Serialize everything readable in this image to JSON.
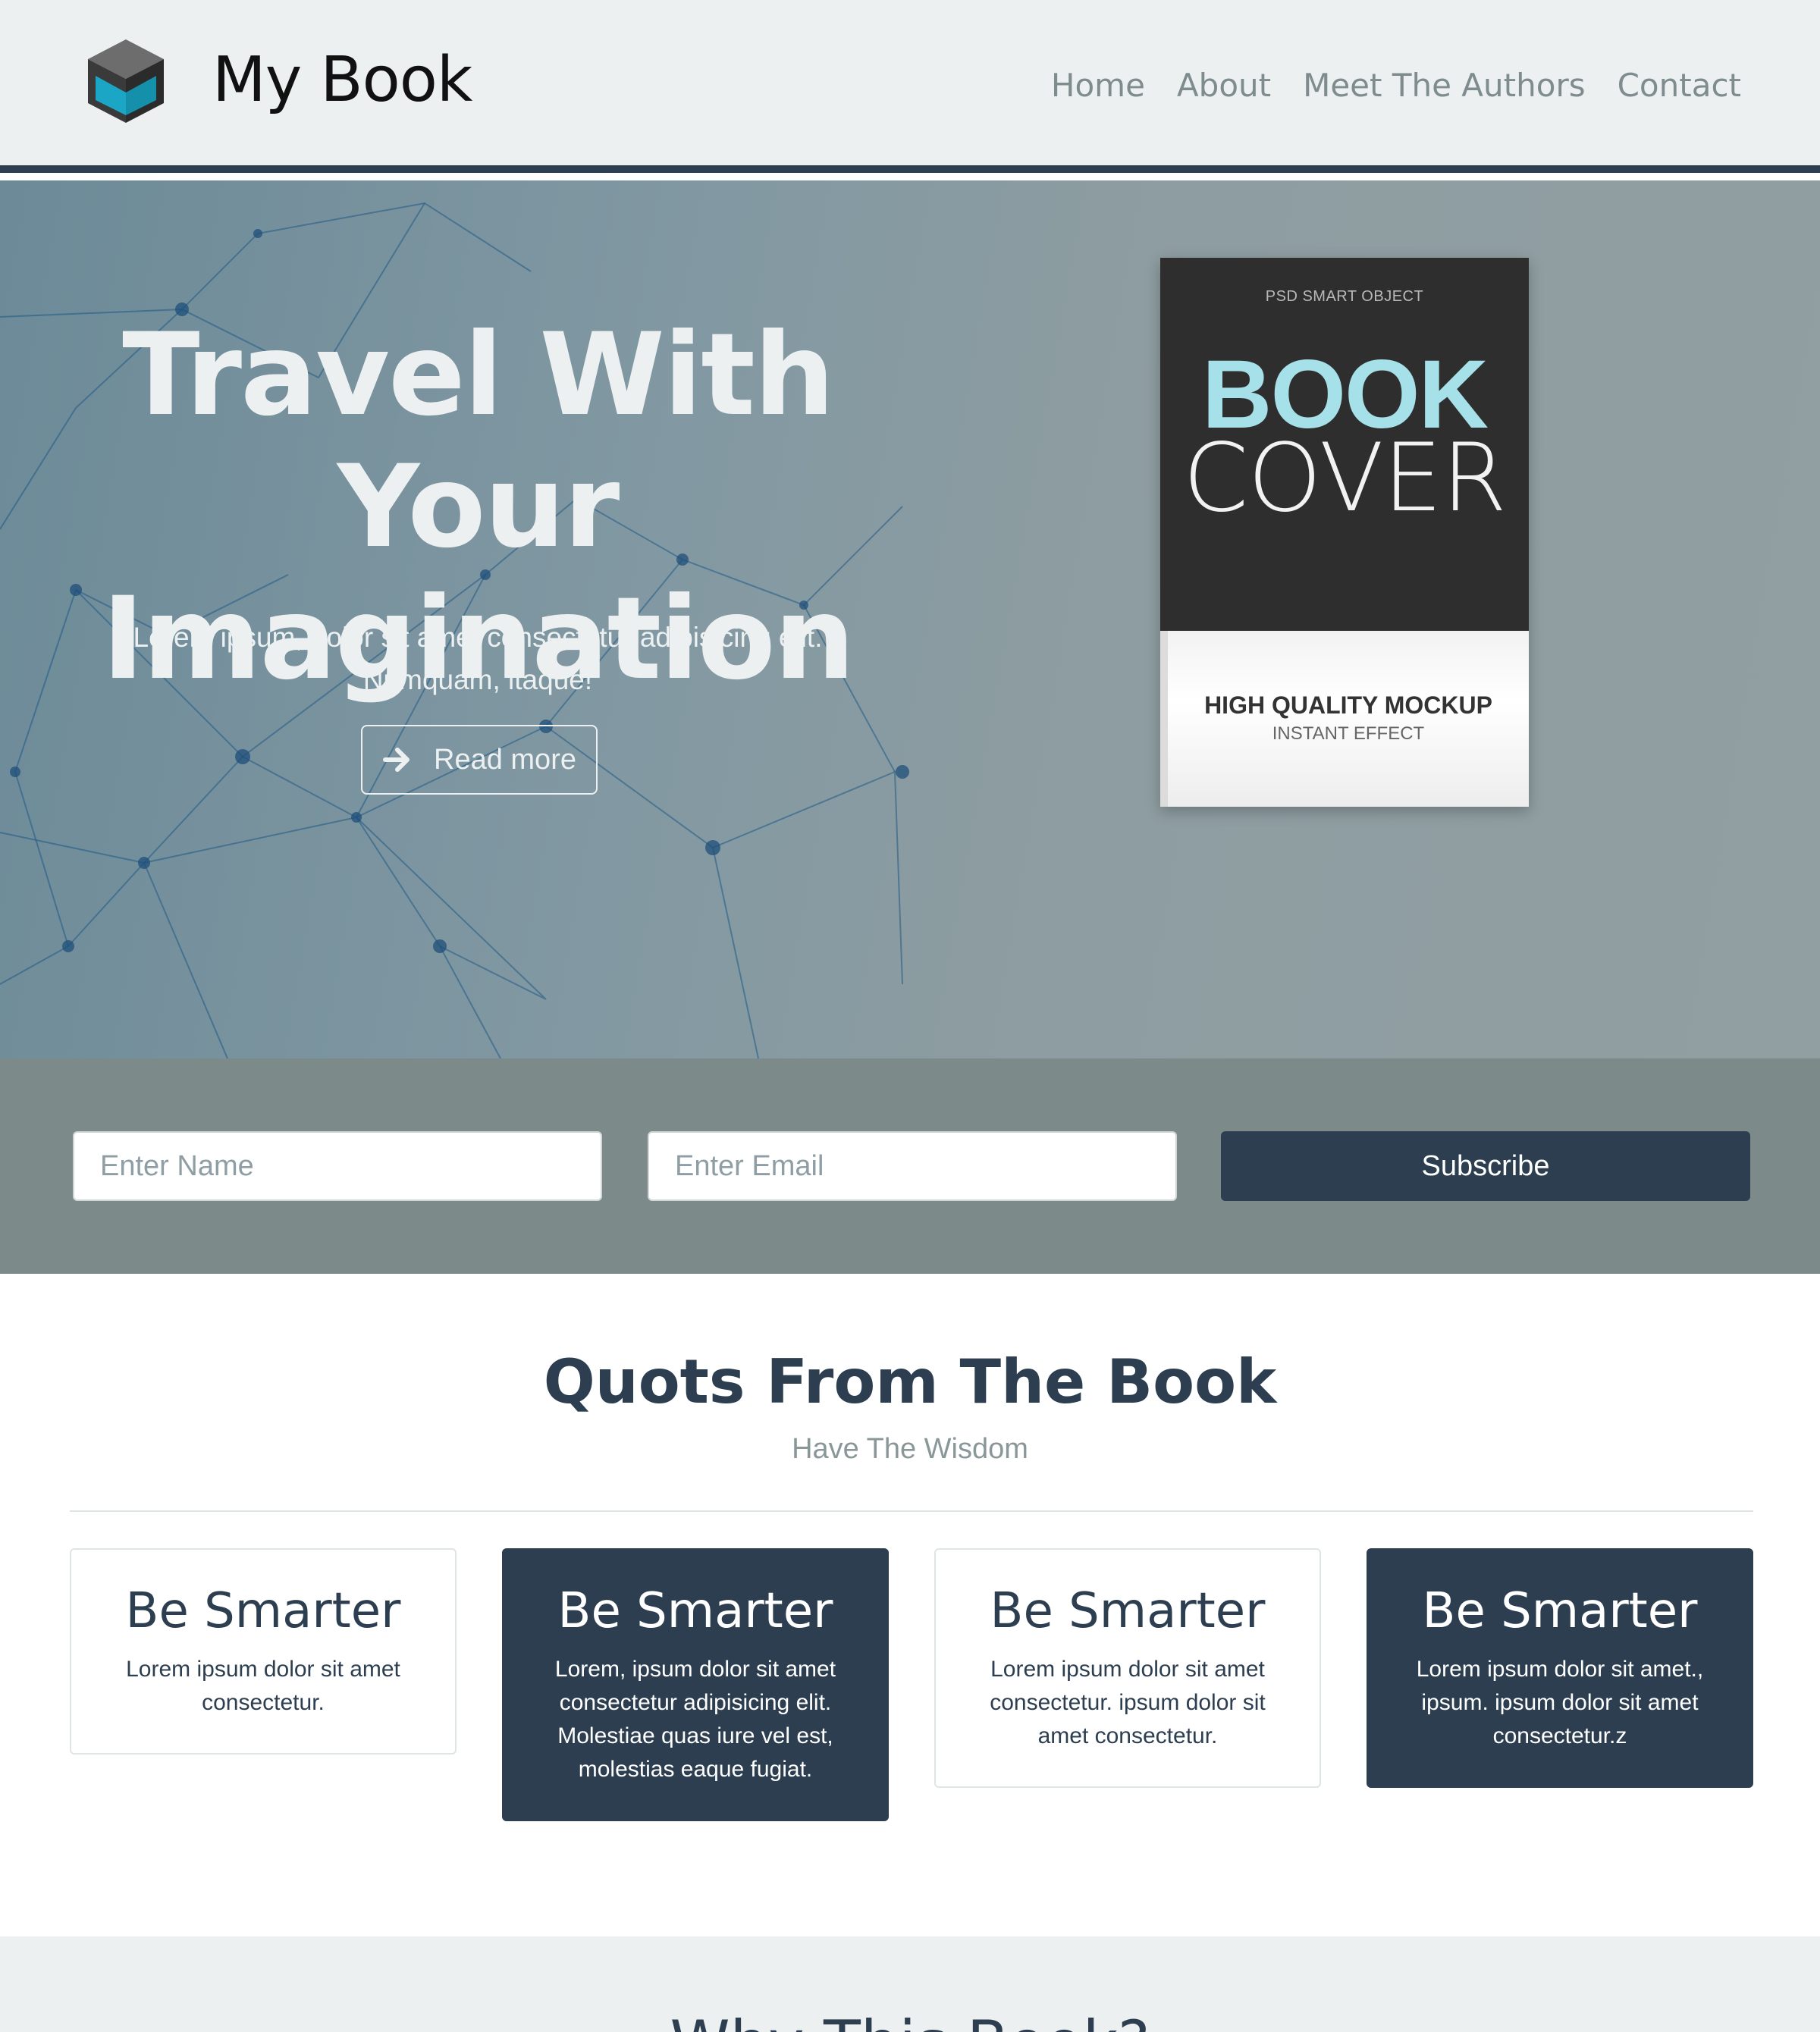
{
  "nav": {
    "brand": "My Book",
    "links": [
      "Home",
      "About",
      "Meet The Authors",
      "Contact"
    ]
  },
  "hero": {
    "title_line1": "Travel With Your",
    "title_line2": "Imagination",
    "text_line1": "Lorem ipsum, dolor sit amet consectetur adipisicing elit.",
    "text_line2": "Numquam, itaque!",
    "button_label": "Read more",
    "book": {
      "smart_object": "PSD SMART OBJECT",
      "big_word": "BOOK",
      "cover_word": "COVER",
      "quality": "HIGH QUALITY MOCKUP",
      "effect": "INSTANT EFFECT"
    }
  },
  "subscribe": {
    "name_placeholder": "Enter Name",
    "email_placeholder": "Enter Email",
    "button_label": "Subscribe"
  },
  "quotes": {
    "title": "Quots From The Book",
    "subtitle": "Have The Wisdom",
    "cards": [
      {
        "heading": "Be Smarter",
        "text": "Lorem ipsum dolor sit amet consectetur."
      },
      {
        "heading": "Be Smarter",
        "text": "Lorem, ipsum dolor sit amet consectetur adipisicing elit. Molestiae quas iure vel est, molestias eaque fugiat."
      },
      {
        "heading": "Be Smarter",
        "text": "Lorem ipsum dolor sit amet consectetur. ipsum dolor sit amet consectetur."
      },
      {
        "heading": "Be Smarter",
        "text": "Lorem ipsum dolor sit amet., ipsum. ipsum dolor sit amet consectetur.z"
      }
    ]
  },
  "why": {
    "title": "Why This Book?"
  },
  "colors": {
    "primary": "#2c3e50",
    "light": "#ecf0f1",
    "muted": "#7f8c8d",
    "accent_cyan": "#1aa6c4"
  }
}
